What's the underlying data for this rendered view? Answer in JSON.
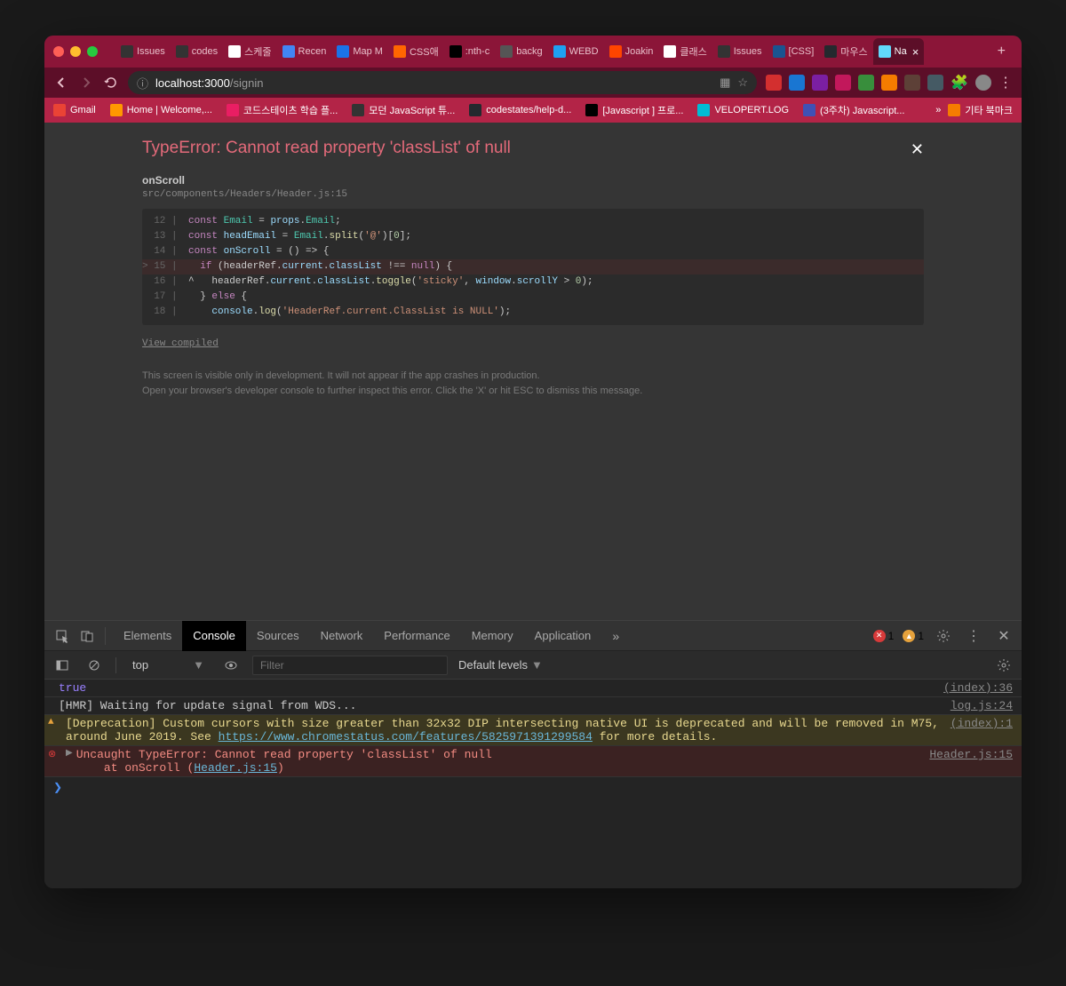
{
  "window": {
    "tabs": [
      {
        "label": "Issues",
        "favicon_bg": "#333"
      },
      {
        "label": "codes",
        "favicon_bg": "#333"
      },
      {
        "label": "스케줄",
        "favicon_bg": "#fff"
      },
      {
        "label": "Recen",
        "favicon_bg": "#4285f4"
      },
      {
        "label": "Map M",
        "favicon_bg": "#1a73e8"
      },
      {
        "label": "CSS애",
        "favicon_bg": "#ff6600"
      },
      {
        "label": ":nth-c",
        "favicon_bg": "#000"
      },
      {
        "label": "backg",
        "favicon_bg": "#555"
      },
      {
        "label": "WEBD",
        "favicon_bg": "#1da1f2"
      },
      {
        "label": "Joakin",
        "favicon_bg": "#ff4500"
      },
      {
        "label": "클래스",
        "favicon_bg": "#fff"
      },
      {
        "label": "Issues",
        "favicon_bg": "#333"
      },
      {
        "label": "[CSS]",
        "favicon_bg": "#1a5490"
      },
      {
        "label": "마우스",
        "favicon_bg": "#24292e"
      },
      {
        "label": "Na",
        "favicon_bg": "#61dafb",
        "active": true
      }
    ]
  },
  "address": {
    "host": "localhost:",
    "port": "3000",
    "path": "/signin"
  },
  "bookmarks": [
    {
      "label": "Gmail",
      "bg": "#ea4335"
    },
    {
      "label": "Home | Welcome,...",
      "bg": "#ff9800"
    },
    {
      "label": "코드스테이츠 학습 플...",
      "bg": "#e91e63"
    },
    {
      "label": "모던 JavaScript 튜...",
      "bg": "#333"
    },
    {
      "label": "codestates/help-d...",
      "bg": "#24292e"
    },
    {
      "label": "[Javascript ] 프로...",
      "bg": "#000"
    },
    {
      "label": "VELOPERT.LOG",
      "bg": "#00bcd4"
    },
    {
      "label": "(3주차) Javascript...",
      "bg": "#3f51b5"
    }
  ],
  "bookmarks_more": "기타 북마크",
  "error": {
    "title": "TypeError: Cannot read property 'classList' of null",
    "fn": "onScroll",
    "loc": "src/components/Headers/Header.js:15",
    "lines": [
      {
        "n": "12",
        "gutter": "  12 | ",
        "code": [
          {
            "t": "const ",
            "c": "kw"
          },
          {
            "t": "Email",
            "c": "id"
          },
          {
            "t": " = ",
            "c": "op"
          },
          {
            "t": "props",
            "c": "var"
          },
          {
            "t": ".",
            "c": "op"
          },
          {
            "t": "Email",
            "c": "id"
          },
          {
            "t": ";",
            "c": "op"
          }
        ]
      },
      {
        "n": "13",
        "gutter": "  13 | ",
        "code": [
          {
            "t": "const ",
            "c": "kw"
          },
          {
            "t": "headEmail",
            "c": "var"
          },
          {
            "t": " = ",
            "c": "op"
          },
          {
            "t": "Email",
            "c": "id"
          },
          {
            "t": ".",
            "c": "op"
          },
          {
            "t": "split",
            "c": "prop"
          },
          {
            "t": "(",
            "c": "op"
          },
          {
            "t": "'@'",
            "c": "str"
          },
          {
            "t": ")[",
            "c": "op"
          },
          {
            "t": "0",
            "c": "num"
          },
          {
            "t": "];",
            "c": "op"
          }
        ]
      },
      {
        "n": "14",
        "gutter": "  14 | ",
        "code": [
          {
            "t": "const ",
            "c": "kw"
          },
          {
            "t": "onScroll",
            "c": "var"
          },
          {
            "t": " = () => {",
            "c": "op"
          }
        ]
      },
      {
        "n": "15",
        "gutter": "> 15 | ",
        "hl": true,
        "code": [
          {
            "t": "  if ",
            "c": "kw"
          },
          {
            "t": "(headerRef",
            "c": "op"
          },
          {
            "t": ".",
            "c": "op"
          },
          {
            "t": "current",
            "c": "var"
          },
          {
            "t": ".",
            "c": "op"
          },
          {
            "t": "classList",
            "c": "var"
          },
          {
            "t": " !== ",
            "c": "op"
          },
          {
            "t": "null",
            "c": "kw"
          },
          {
            "t": ") {",
            "c": "op"
          }
        ]
      },
      {
        "n": "16",
        "gutter": "  16 | ",
        "code": [
          {
            "t": "^   headerRef",
            "c": "op"
          },
          {
            "t": ".",
            "c": "op"
          },
          {
            "t": "current",
            "c": "var"
          },
          {
            "t": ".",
            "c": "op"
          },
          {
            "t": "classList",
            "c": "var"
          },
          {
            "t": ".",
            "c": "op"
          },
          {
            "t": "toggle",
            "c": "prop"
          },
          {
            "t": "(",
            "c": "op"
          },
          {
            "t": "'sticky'",
            "c": "str"
          },
          {
            "t": ", ",
            "c": "op"
          },
          {
            "t": "window",
            "c": "var"
          },
          {
            "t": ".",
            "c": "op"
          },
          {
            "t": "scrollY",
            "c": "var"
          },
          {
            "t": " > ",
            "c": "op"
          },
          {
            "t": "0",
            "c": "num"
          },
          {
            "t": ");",
            "c": "op"
          }
        ]
      },
      {
        "n": "17",
        "gutter": "  17 | ",
        "code": [
          {
            "t": "  } ",
            "c": "op"
          },
          {
            "t": "else ",
            "c": "kw"
          },
          {
            "t": "{",
            "c": "op"
          }
        ]
      },
      {
        "n": "18",
        "gutter": "  18 | ",
        "code": [
          {
            "t": "    console",
            "c": "var"
          },
          {
            "t": ".",
            "c": "op"
          },
          {
            "t": "log",
            "c": "prop"
          },
          {
            "t": "(",
            "c": "op"
          },
          {
            "t": "'HeaderRef.current.ClassList is NULL'",
            "c": "str"
          },
          {
            "t": ");",
            "c": "op"
          }
        ]
      }
    ],
    "view_compiled": "View compiled",
    "note1": "This screen is visible only in development. It will not appear if the app crashes in production.",
    "note2": "Open your browser's developer console to further inspect this error.  Click the 'X' or hit ESC to dismiss this message."
  },
  "devtools": {
    "tabs": [
      "Elements",
      "Console",
      "Sources",
      "Network",
      "Performance",
      "Memory",
      "Application"
    ],
    "active_tab": "Console",
    "err_count": "1",
    "warn_count": "1",
    "context": "top",
    "filter_placeholder": "Filter",
    "levels": "Default levels",
    "lines": [
      {
        "type": "log",
        "msg": "true",
        "src": "(index):36",
        "true": true
      },
      {
        "type": "log",
        "msg": "[HMR] Waiting for update signal from WDS...",
        "src": "log.js:24"
      },
      {
        "type": "warn",
        "msg_pre": "[Deprecation] Custom cursors with size greater than 32x32 DIP intersecting native UI is deprecated and will be removed in M75, around June 2019. See ",
        "link": "https://www.chromestatus.com/features/5825971391299584",
        "msg_post": " for more details.",
        "src": "(index):1"
      },
      {
        "type": "err",
        "msg": "Uncaught TypeError: Cannot read property 'classList' of null\n    at onScroll (",
        "link": "Header.js:15",
        "msg_post": ")",
        "src": "Header.js:15"
      }
    ]
  }
}
